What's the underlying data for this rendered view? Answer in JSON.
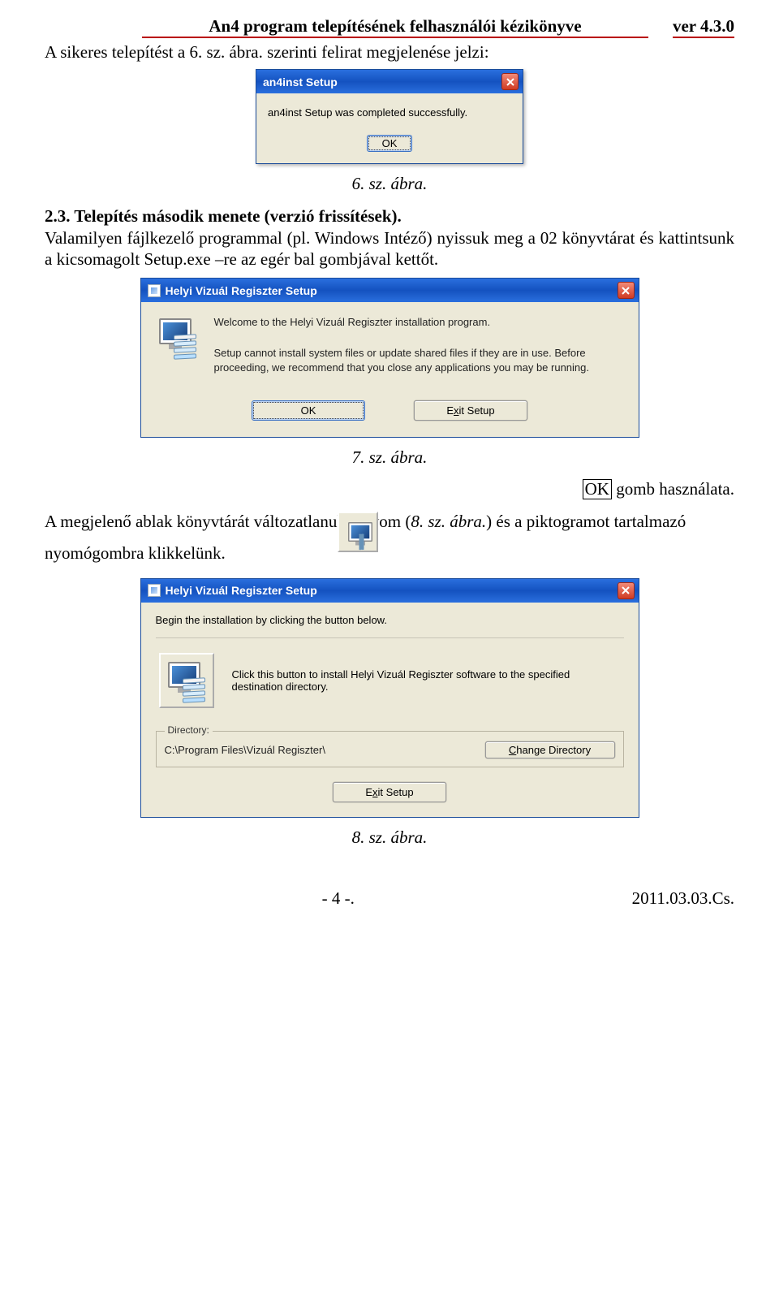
{
  "header": {
    "title": "An4 program telepítésének felhasználói kézikönyve",
    "version": "ver 4.3.0"
  },
  "line1": "A sikeres telepítést a 6. sz. ábra. szerinti felirat megjelenése jelzi:",
  "fig6": {
    "title": "an4inst Setup",
    "message": "an4inst Setup was completed successfully.",
    "ok": "OK",
    "caption": "6. sz. ábra."
  },
  "section2_3": {
    "heading": "2.3. Telepítés második menete (verzió frissítések).",
    "para": "Valamilyen fájlkezelő programmal (pl. Windows Intéző) nyissuk meg a 02 könyvtárat és kattintsunk a kicsomagolt Setup.exe –re az egér bal gombjával kettőt."
  },
  "fig7": {
    "title": "Helyi Vizuál Regiszter Setup",
    "welcome": "Welcome to the Helyi Vizuál Regiszter installation program.",
    "warn": "Setup cannot install system files or update shared files if they are in use. Before proceeding, we recommend that you close any applications you may be running.",
    "ok": "OK",
    "exit_prefix": "E",
    "exit_x": "x",
    "exit_suffix": "it Setup",
    "caption": "7. sz. ábra."
  },
  "ok_usage": {
    "boxed": "OK",
    "after": " gomb használata."
  },
  "line2": {
    "pre": "A megjelenő ablak könyvtárát változatlanul hagyom (",
    "ital": "8. sz. ábra.",
    "post": ") és a piktogramot tartalmazó"
  },
  "line3": "nyomógombra klikkelünk.",
  "fig8": {
    "title": "Helyi Vizuál Regiszter Setup",
    "begin": "Begin the installation by clicking the button below.",
    "click": "Click this button to install Helyi Vizuál Regiszter software to the specified destination directory.",
    "dir_group": "Directory:",
    "dir_path": "C:\\Program Files\\Vizuál Regiszter\\",
    "change_c": "C",
    "change_suffix": "hange Directory",
    "exit_prefix": "E",
    "exit_x": "x",
    "exit_suffix": "it Setup",
    "caption": "8. sz. ábra."
  },
  "footer": {
    "page": "- 4 -.",
    "date": "2011.03.03.Cs."
  }
}
